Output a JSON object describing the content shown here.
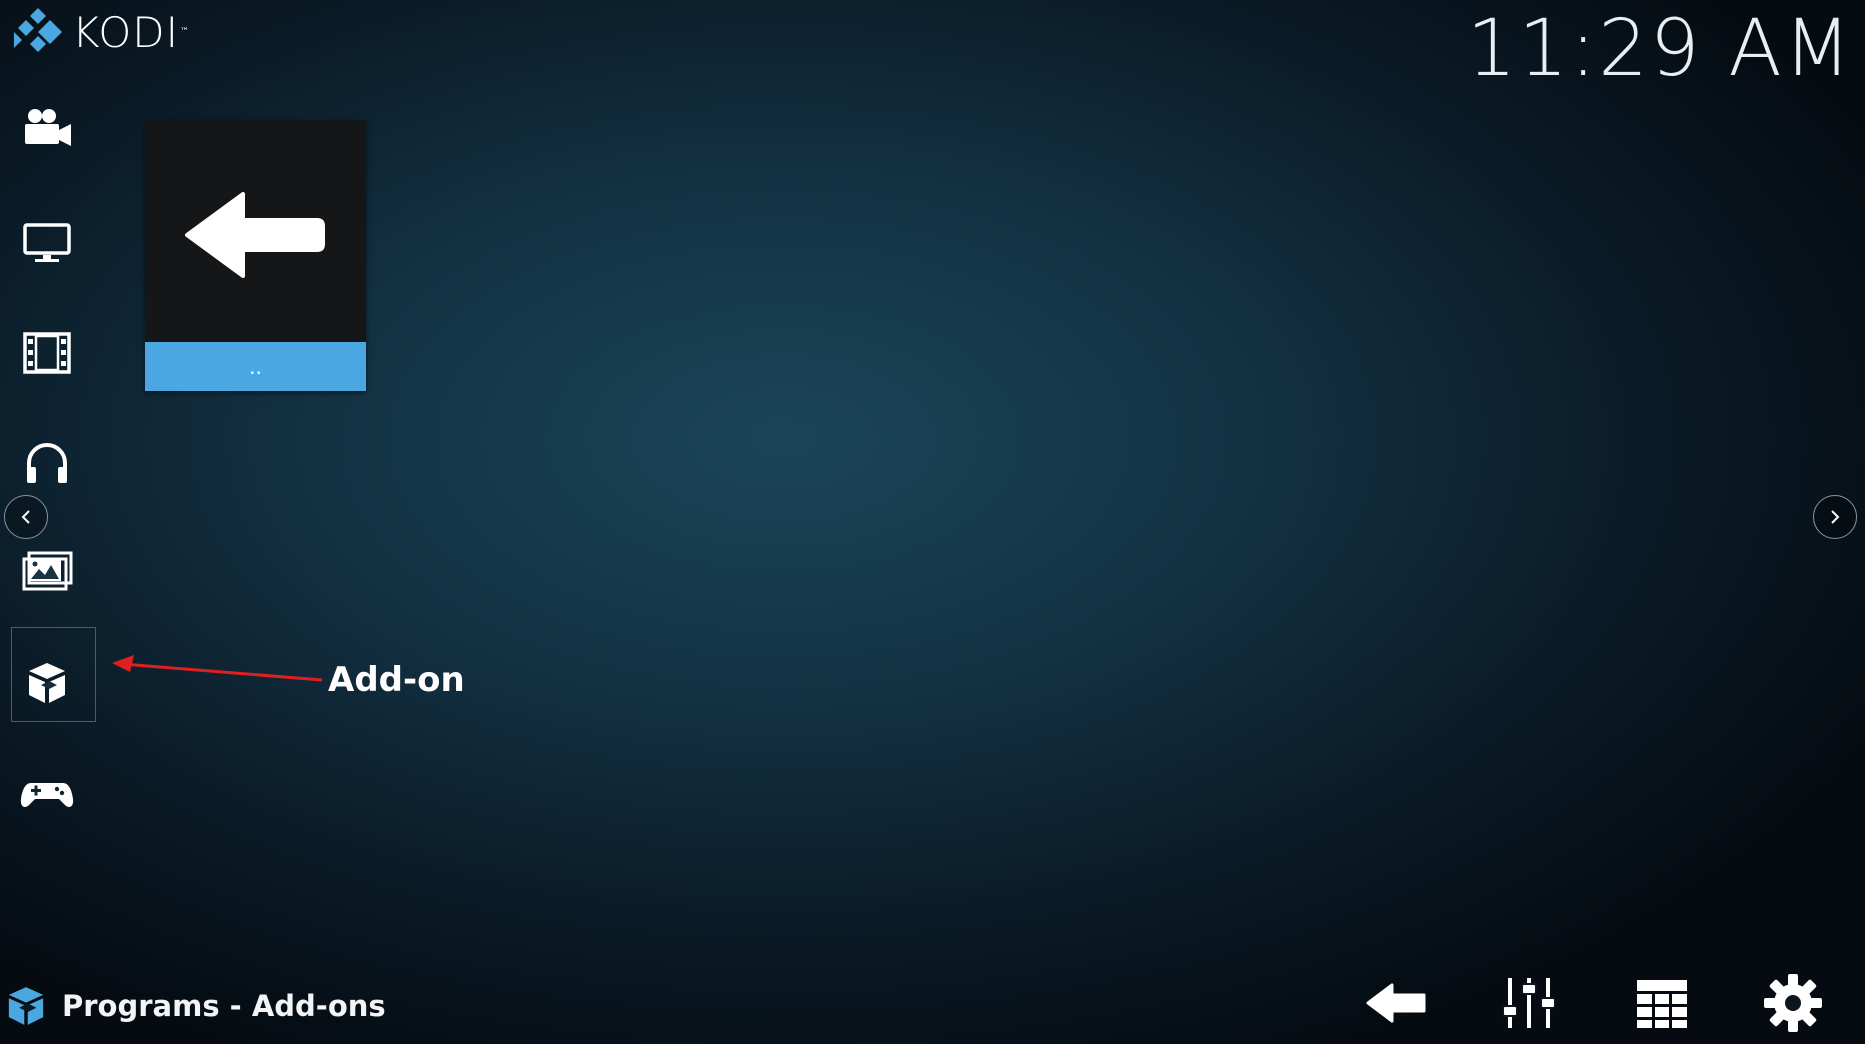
{
  "app": {
    "name": "KODI",
    "tm": "™"
  },
  "clock": "11:29 AM",
  "sidebar": {
    "items": [
      {
        "name": "Movies",
        "icon": "video-camera-icon"
      },
      {
        "name": "TV shows",
        "icon": "tv-icon"
      },
      {
        "name": "Music videos",
        "icon": "film-icon"
      },
      {
        "name": "Music",
        "icon": "headphones-icon"
      },
      {
        "name": "Pictures",
        "icon": "pictures-icon"
      },
      {
        "name": "Add-ons",
        "icon": "addon-box-icon"
      },
      {
        "name": "Games",
        "icon": "gamepad-icon"
      }
    ]
  },
  "content": {
    "tiles": [
      {
        "label": "..",
        "icon": "back-arrow-icon"
      }
    ]
  },
  "annotation": {
    "label": "Add-on",
    "color": "#e02020"
  },
  "footer": {
    "title": "Programs - Add-ons",
    "title_icon": "addon-box-icon",
    "buttons": [
      "back-arrow-icon",
      "sliders-icon",
      "grid-icon",
      "gear-icon"
    ]
  },
  "colors": {
    "accent": "#4ba7e1",
    "annotation": "#e02020"
  }
}
